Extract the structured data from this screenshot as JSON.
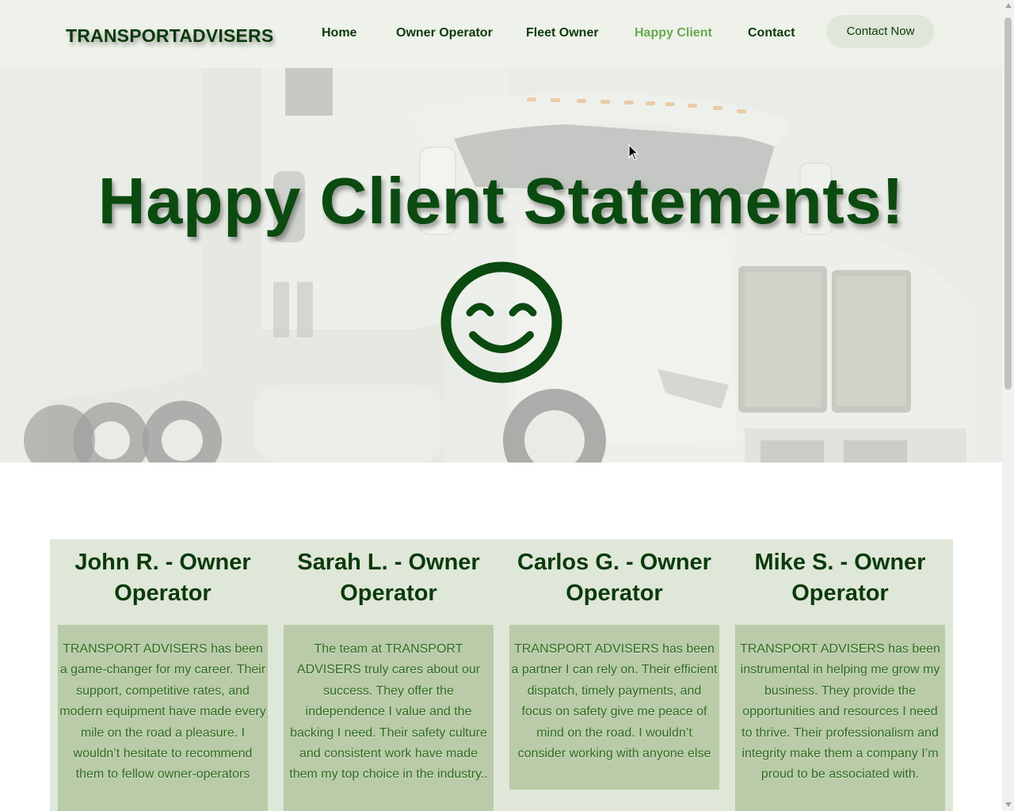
{
  "header": {
    "logo": "TRANSPORTADVISERS",
    "nav": [
      {
        "label": "Home",
        "active": false
      },
      {
        "label": "Owner Operator",
        "active": false
      },
      {
        "label": "Fleet Owner",
        "active": false
      },
      {
        "label": "Happy Client",
        "active": true
      },
      {
        "label": "Contact",
        "active": false
      }
    ],
    "cta_label": "Contact Now"
  },
  "hero": {
    "title": "Happy Client Statements!",
    "icon": "smiley-face-icon"
  },
  "testimonials": [
    {
      "name": "John R. - Owner Operator",
      "text": "TRANSPORT ADVISERS has been a game-changer for my career. Their support, competitive rates, and modern equipment have made every mile on the road a pleasure. I wouldn’t hesitate to recommend them to fellow owner-operators"
    },
    {
      "name": "Sarah L. - Owner Operator",
      "text": "The team at TRANSPORT ADVISERS truly cares about our success. They offer the independence I value and the backing I need. Their safety culture and consistent work have made them my top choice in the industry.."
    },
    {
      "name": "Carlos G. - Owner Operator",
      "text": "TRANSPORT ADVISERS has been a partner I can rely on. Their efficient dispatch, timely payments, and focus on safety give me peace of mind on the road. I wouldn’t consider working with anyone else"
    },
    {
      "name": "Mike S. - Owner Operator",
      "text": "TRANSPORT ADVISERS has been instrumental in helping me grow my business. They provide the opportunities and resources I need to thrive. Their professionalism and integrity make them a company I’m proud to be associated with."
    }
  ],
  "colors": {
    "brand_dark_green": "#0b3a0b",
    "active_nav": "#6aa84f",
    "card_panel": "#dfe7d8",
    "card_body": "#b9cba8"
  }
}
